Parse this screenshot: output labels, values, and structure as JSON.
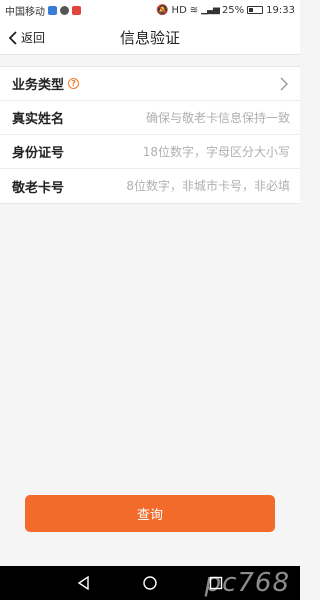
{
  "status_bar": {
    "carrier": "中国移动",
    "network": "HD",
    "battery": "25%",
    "time": "19:33"
  },
  "header": {
    "back_label": "返回",
    "title": "信息验证"
  },
  "form": {
    "rows": [
      {
        "label": "业务类型",
        "placeholder": "",
        "has_help": true,
        "has_chevron": true
      },
      {
        "label": "真实姓名",
        "placeholder": "确保与敬老卡信息保持一致"
      },
      {
        "label": "身份证号",
        "placeholder": "18位数字，字母区分大小写"
      },
      {
        "label": "敬老卡号",
        "placeholder": "8位数字，非城市卡号，非必填"
      }
    ]
  },
  "actions": {
    "query_label": "查询"
  },
  "watermark": "pc768",
  "colors": {
    "accent": "#f26b2a",
    "background": "#f5f5f5"
  },
  "icons": [
    "chevron-left-icon",
    "help-icon",
    "chevron-right-icon",
    "nav-back-icon",
    "nav-home-icon",
    "nav-recent-icon"
  ]
}
